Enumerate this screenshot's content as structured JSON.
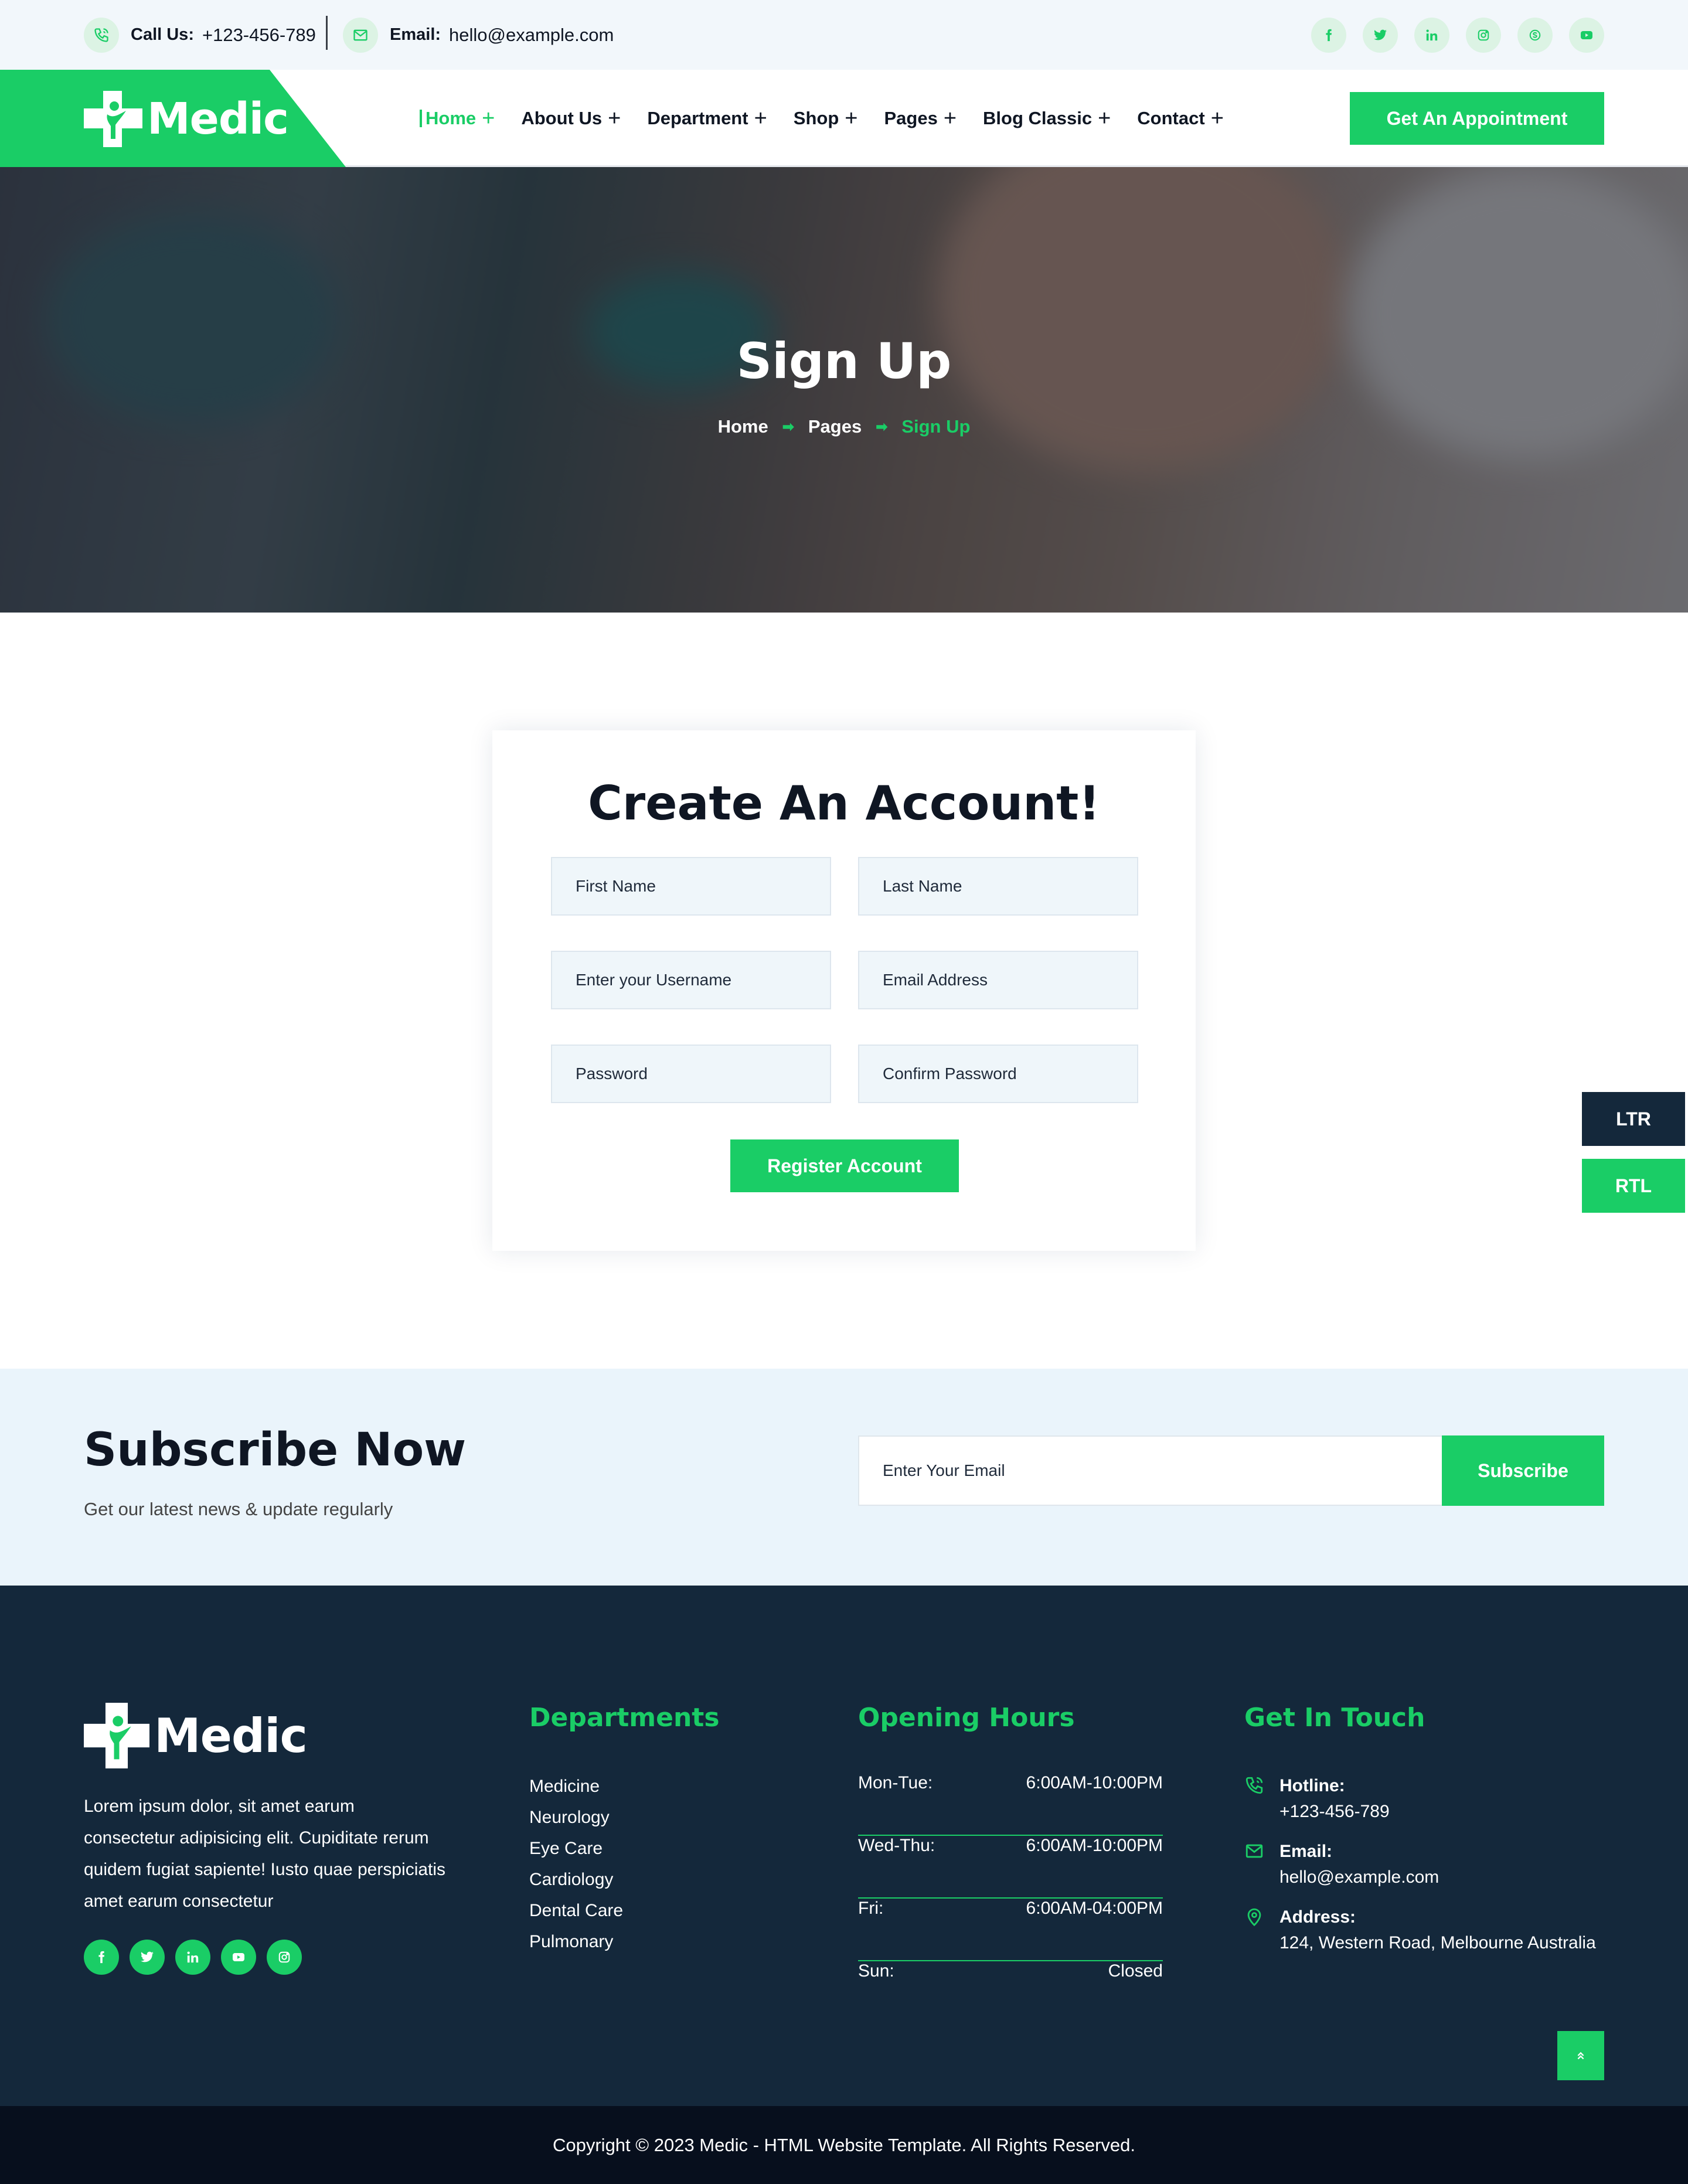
{
  "topbar": {
    "call_label": "Call Us:",
    "call_value": "+123-456-789",
    "email_label": "Email:",
    "email_value": "hello@example.com",
    "socials": [
      "facebook-icon",
      "twitter-icon",
      "linkedin-icon",
      "instagram-icon",
      "skype-icon",
      "youtube-icon"
    ]
  },
  "brand": {
    "name": "Medic",
    "accent": "#1acd66",
    "dark": "#14283b"
  },
  "nav": {
    "items": [
      {
        "label": "Home",
        "active": true
      },
      {
        "label": "About Us",
        "active": false
      },
      {
        "label": "Department",
        "active": false
      },
      {
        "label": "Shop",
        "active": false
      },
      {
        "label": "Pages",
        "active": false
      },
      {
        "label": "Blog Classic",
        "active": false
      },
      {
        "label": "Contact",
        "active": false
      }
    ],
    "cta": "Get An Appointment"
  },
  "hero": {
    "title": "Sign Up",
    "breadcrumb": [
      "Home",
      "Pages",
      "Sign Up"
    ]
  },
  "form": {
    "title": "Create An Account!",
    "first_name": "First Name",
    "last_name": "Last Name",
    "username": "Enter your Username",
    "email": "Email Address",
    "password": "Password",
    "confirm_password": "Confirm Password",
    "submit": "Register Account"
  },
  "direction": {
    "ltr": "LTR",
    "rtl": "RTL"
  },
  "subscribe": {
    "title": "Subscribe Now",
    "subtitle": "Get our latest news & update regularly",
    "placeholder": "Enter Your Email",
    "button": "Subscribe"
  },
  "footer": {
    "about": "Lorem ipsum dolor, sit amet earum consectetur adipisicing elit. Cupiditate rerum quidem fugiat sapiente! Iusto quae perspiciatis amet earum consectetur",
    "departments_title": "Departments",
    "departments": [
      "Medicine",
      "Neurology",
      "Eye Care",
      "Cardiology",
      "Dental Care",
      "Pulmonary"
    ],
    "hours_title": "Opening Hours",
    "hours": [
      {
        "day": "Mon-Tue:",
        "time": "6:00AM-10:00PM"
      },
      {
        "day": "Wed-Thu:",
        "time": "6:00AM-10:00PM"
      },
      {
        "day": "Fri:",
        "time": "6:00AM-04:00PM"
      },
      {
        "day": "Sun:",
        "time": "Closed"
      }
    ],
    "touch_title": "Get In Touch",
    "hotline_label": "Hotline:",
    "hotline": "+123-456-789",
    "email_label": "Email:",
    "email": "hello@example.com",
    "address_label": "Address:",
    "address": "124, Western Road, Melbourne Australia",
    "copyright": "Copyright © 2023 Medic - HTML Website Template. All Rights Reserved."
  }
}
